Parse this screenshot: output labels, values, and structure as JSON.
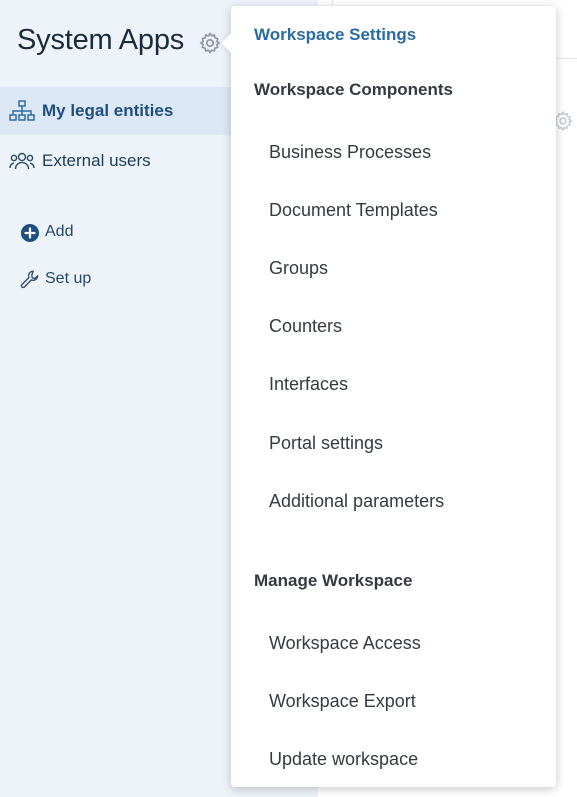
{
  "sidebar": {
    "title": "System Apps",
    "items": [
      {
        "label": "My legal entities",
        "icon": "org-structure-icon",
        "active": true
      },
      {
        "label": "External users",
        "icon": "users-icon",
        "active": false
      }
    ],
    "actions": [
      {
        "label": "Add",
        "icon": "plus-circle-icon"
      },
      {
        "label": "Set up",
        "icon": "wrench-icon"
      }
    ]
  },
  "dropdown": {
    "title": "Workspace Settings",
    "sections": [
      {
        "heading": "Workspace Components",
        "items": [
          "Business Processes",
          "Document Templates",
          "Groups",
          "Counters",
          "Interfaces",
          "Portal settings",
          "Additional parameters"
        ]
      },
      {
        "heading": "Manage Workspace",
        "items": [
          "Workspace Access",
          "Workspace Export",
          "Update workspace"
        ]
      }
    ]
  },
  "colors": {
    "accent": "#2a6ba3",
    "sidebar_bg": "#eef3fa",
    "active_bg": "#dce8f5"
  }
}
